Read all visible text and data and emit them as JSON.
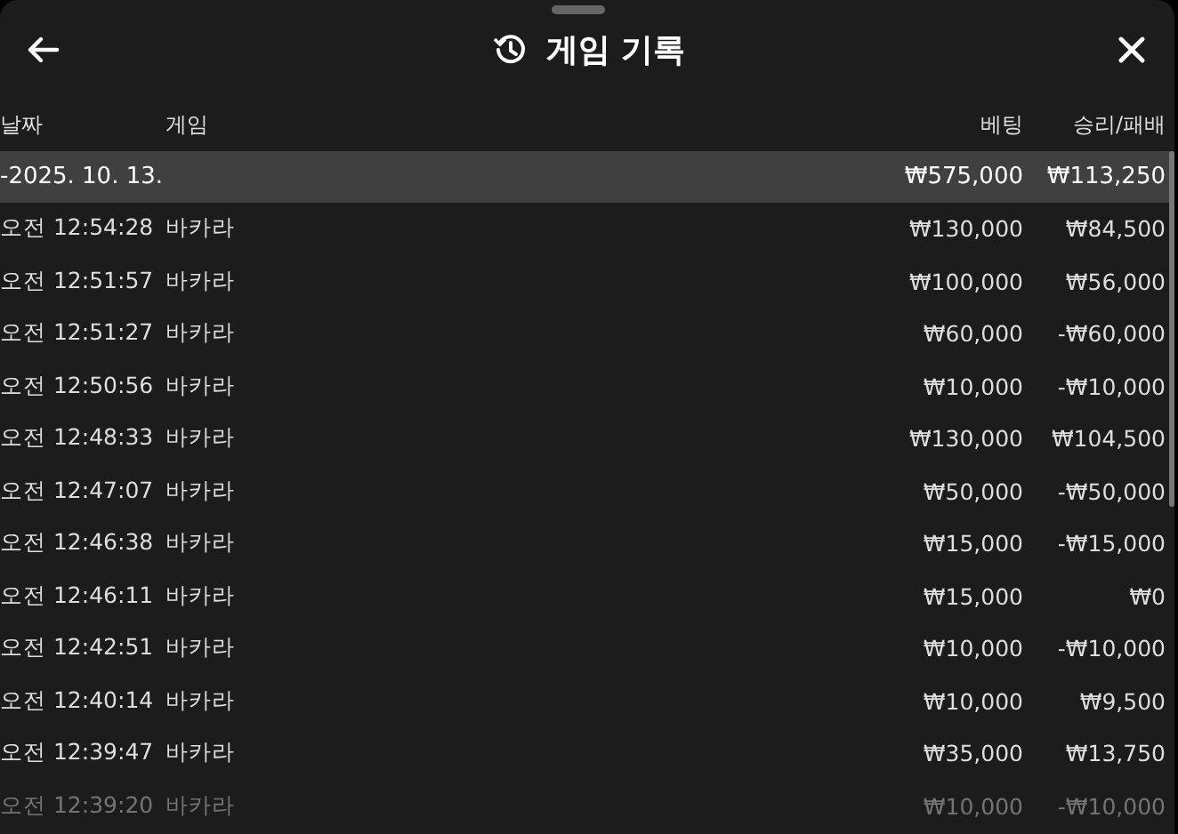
{
  "header": {
    "title": "게임 기록"
  },
  "table": {
    "columns": [
      "날짜",
      "게임",
      "베팅",
      "승리/패배"
    ],
    "day_summary": {
      "date": "-2025. 10. 13.",
      "bet": "₩575,000",
      "result": "₩113,250"
    },
    "rows": [
      {
        "time": "오전 12:54:28",
        "game": "바카라",
        "bet": "₩130,000",
        "result": "₩84,500"
      },
      {
        "time": "오전 12:51:57",
        "game": "바카라",
        "bet": "₩100,000",
        "result": "₩56,000"
      },
      {
        "time": "오전 12:51:27",
        "game": "바카라",
        "bet": "₩60,000",
        "result": "-₩60,000"
      },
      {
        "time": "오전 12:50:56",
        "game": "바카라",
        "bet": "₩10,000",
        "result": "-₩10,000"
      },
      {
        "time": "오전 12:48:33",
        "game": "바카라",
        "bet": "₩130,000",
        "result": "₩104,500"
      },
      {
        "time": "오전 12:47:07",
        "game": "바카라",
        "bet": "₩50,000",
        "result": "-₩50,000"
      },
      {
        "time": "오전 12:46:38",
        "game": "바카라",
        "bet": "₩15,000",
        "result": "-₩15,000"
      },
      {
        "time": "오전 12:46:11",
        "game": "바카라",
        "bet": "₩15,000",
        "result": "₩0"
      },
      {
        "time": "오전 12:42:51",
        "game": "바카라",
        "bet": "₩10,000",
        "result": "-₩10,000"
      },
      {
        "time": "오전 12:40:14",
        "game": "바카라",
        "bet": "₩10,000",
        "result": "₩9,500"
      },
      {
        "time": "오전 12:39:47",
        "game": "바카라",
        "bet": "₩35,000",
        "result": "₩13,750"
      },
      {
        "time": "오전 12:39:20",
        "game": "바카라",
        "bet": "₩10,000",
        "result": "-₩10,000"
      }
    ]
  }
}
